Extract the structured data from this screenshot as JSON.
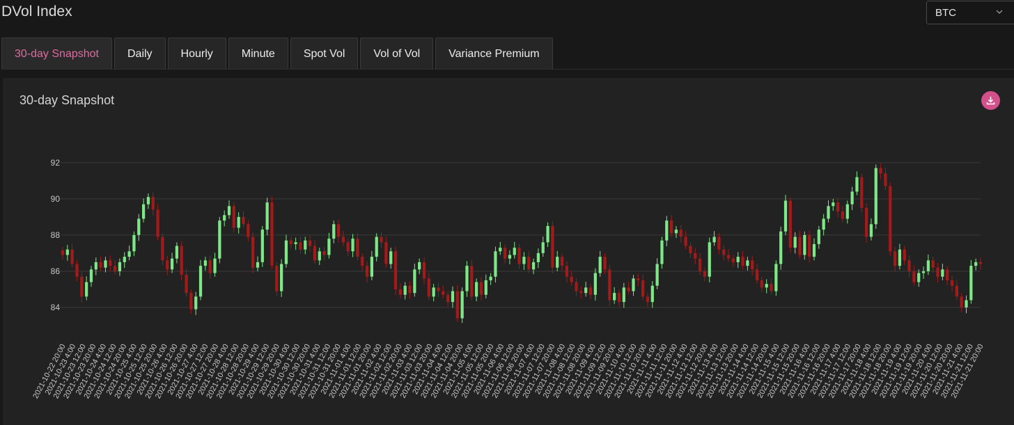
{
  "header": {
    "title": "DVol Index",
    "asset_select": {
      "value": "BTC"
    }
  },
  "tabs": [
    {
      "label": "30-day Snapshot",
      "active": true
    },
    {
      "label": "Daily",
      "active": false
    },
    {
      "label": "Hourly",
      "active": false
    },
    {
      "label": "Minute",
      "active": false
    },
    {
      "label": "Spot Vol",
      "active": false
    },
    {
      "label": "Vol of Vol",
      "active": false
    },
    {
      "label": "Variance Premium",
      "active": false
    }
  ],
  "panel": {
    "title": "30-day Snapshot",
    "download_icon": "download-icon"
  },
  "colors": {
    "accent": "#dd6c9f",
    "up": "#7ee787",
    "down": "#a31a1a",
    "grid": "#3a3a3a",
    "tick_text": "#c8c8c8"
  },
  "chart_data": {
    "type": "candlestick",
    "title": "30-day Snapshot",
    "ylim": [
      83,
      93.3
    ],
    "yticks": [
      84,
      86,
      88,
      90,
      92
    ],
    "grid": "horizontal",
    "xticks": [
      "2021-10-22 20:00",
      "2021-10-23 4:00",
      "2021-10-23 12:00",
      "2021-10-23 20:00",
      "2021-10-24 4:00",
      "2021-10-24 12:00",
      "2021-10-24 20:00",
      "2021-10-25 4:00",
      "2021-10-25 12:00",
      "2021-10-25 20:00",
      "2021-10-26 4:00",
      "2021-10-26 12:00",
      "2021-10-26 20:00",
      "2021-10-27 4:00",
      "2021-10-27 12:00",
      "2021-10-27 20:00",
      "2021-10-28 4:00",
      "2021-10-28 12:00",
      "2021-10-28 20:00",
      "2021-10-29 4:00",
      "2021-10-29 12:00",
      "2021-10-29 20:00",
      "2021-10-30 4:00",
      "2021-10-30 12:00",
      "2021-10-30 20:00",
      "2021-10-31 4:00",
      "2021-10-31 12:00",
      "2021-10-31 20:00",
      "2021-11-01 4:00",
      "2021-11-01 12:00",
      "2021-11-01 20:00",
      "2021-11-02 4:00",
      "2021-11-02 12:00",
      "2021-11-02 20:00",
      "2021-11-03 4:00",
      "2021-11-03 12:00",
      "2021-11-03 20:00",
      "2021-11-04 4:00",
      "2021-11-04 12:00",
      "2021-11-04 20:00",
      "2021-11-05 4:00",
      "2021-11-05 12:00",
      "2021-11-05 20:00",
      "2021-11-06 4:00",
      "2021-11-06 12:00",
      "2021-11-06 20:00",
      "2021-11-07 4:00",
      "2021-11-07 12:00",
      "2021-11-07 20:00",
      "2021-11-08 4:00",
      "2021-11-08 12:00",
      "2021-11-08 20:00",
      "2021-11-09 4:00",
      "2021-11-09 12:00",
      "2021-11-09 20:00",
      "2021-11-10 4:00",
      "2021-11-10 12:00",
      "2021-11-10 20:00",
      "2021-11-11 4:00",
      "2021-11-11 12:00",
      "2021-11-11 20:00",
      "2021-11-12 4:00",
      "2021-11-12 12:00",
      "2021-11-12 20:00",
      "2021-11-13 4:00",
      "2021-11-13 12:00",
      "2021-11-13 20:00",
      "2021-11-14 4:00",
      "2021-11-14 12:00",
      "2021-11-14 20:00",
      "2021-11-15 4:00",
      "2021-11-15 12:00",
      "2021-11-15 20:00",
      "2021-11-16 4:00",
      "2021-11-16 12:00",
      "2021-11-16 20:00",
      "2021-11-17 4:00",
      "2021-11-17 12:00",
      "2021-11-17 20:00",
      "2021-11-18 4:00",
      "2021-11-18 12:00",
      "2021-11-18 20:00",
      "2021-11-19 4:00",
      "2021-11-19 12:00",
      "2021-11-19 20:00",
      "2021-11-20 4:00",
      "2021-11-20 12:00",
      "2021-11-20 20:00",
      "2021-11-21 4:00",
      "2021-11-21 12:00",
      "2021-11-21 20:00"
    ],
    "series": [
      {
        "values": [
          86.9,
          87.2,
          86.4,
          85.7,
          84.6,
          85.4,
          86.1,
          86.5,
          86.2,
          86.6,
          86.3,
          86.0,
          86.5,
          86.8,
          87.1,
          88.0,
          88.9,
          89.7,
          90.1,
          89.4,
          87.9,
          86.6,
          86.1,
          86.7,
          87.4,
          85.8,
          84.8,
          83.9,
          84.6,
          86.3,
          86.6,
          85.9,
          86.7,
          88.8,
          89.1,
          89.6,
          88.4,
          89.0,
          88.6,
          87.9,
          86.2,
          86.5,
          88.3,
          89.8,
          86.3,
          84.9,
          86.4,
          87.7,
          87.5,
          87.6,
          87.2,
          87.7,
          87.4,
          86.6,
          87.1,
          86.9,
          87.8,
          88.6,
          87.9,
          87.6,
          87.1,
          87.8,
          86.8,
          86.3,
          85.7,
          86.8,
          87.9,
          87.6,
          86.4,
          87.1,
          85.0,
          84.7,
          85.2,
          84.8,
          86.1,
          86.5,
          85.6,
          84.6,
          85.1,
          84.9,
          84.7,
          84.3,
          84.9,
          83.4,
          84.9,
          86.3,
          84.6,
          85.4,
          84.7,
          85.5,
          85.7,
          87.1,
          87.3,
          86.7,
          86.9,
          87.3,
          86.4,
          86.8,
          86.1,
          86.5,
          87.0,
          87.6,
          88.5,
          86.2,
          86.8,
          86.3,
          85.7,
          85.4,
          84.9,
          84.8,
          85.1,
          84.7,
          85.9,
          86.8,
          86.1,
          84.4,
          84.8,
          84.3,
          85.1,
          84.9,
          85.6,
          85.5,
          84.6,
          84.3,
          85.2,
          86.4,
          87.7,
          88.8,
          88.1,
          88.3,
          87.9,
          87.4,
          87.0,
          86.7,
          86.0,
          85.7,
          87.6,
          87.9,
          87.2,
          86.9,
          86.7,
          86.5,
          86.8,
          86.3,
          86.6,
          86.1,
          85.5,
          85.1,
          85.3,
          84.9,
          86.4,
          88.2,
          89.9,
          87.3,
          87.9,
          86.9,
          88.0,
          86.8,
          87.5,
          88.3,
          88.9,
          89.6,
          89.8,
          89.3,
          88.9,
          89.7,
          90.4,
          91.2,
          89.5,
          87.9,
          88.6,
          91.7,
          91.4,
          90.7,
          87.1,
          86.3,
          87.2,
          86.6,
          86.0,
          85.4,
          85.9,
          86.0,
          86.6,
          86.2,
          85.7,
          86.1,
          85.5,
          85.2,
          84.6,
          84.0,
          84.4,
          86.3,
          86.5,
          86.4
        ]
      }
    ]
  }
}
